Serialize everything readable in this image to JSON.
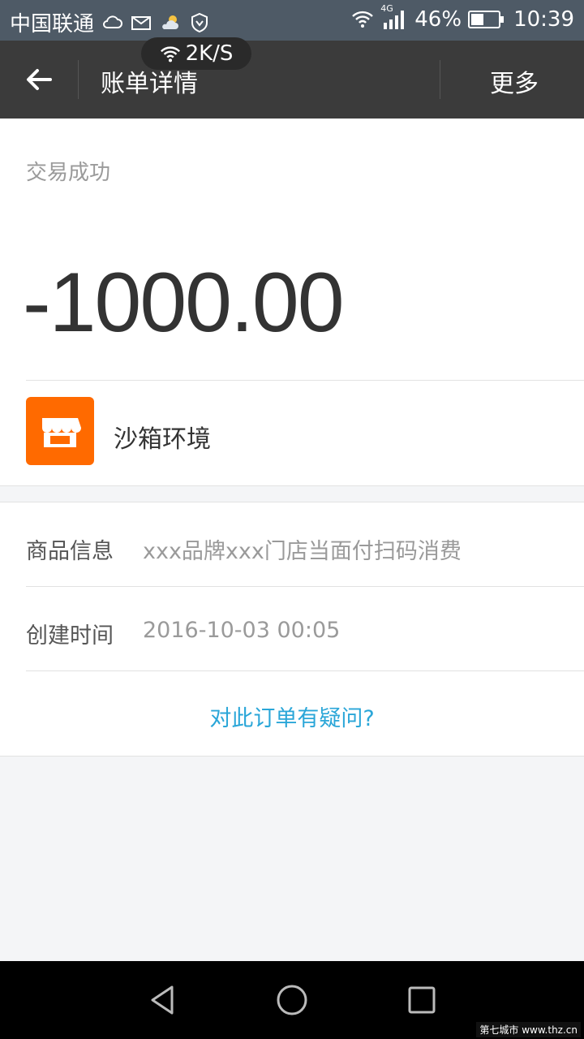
{
  "status_bar": {
    "carrier": "中国联通",
    "network": "4G",
    "battery_percent": "46%",
    "battery_level": 0.46,
    "time": "10:39",
    "net_speed": "2K/S"
  },
  "nav": {
    "title": "账单详情",
    "more_label": "更多"
  },
  "transaction": {
    "status": "交易成功",
    "amount": "-1000.00",
    "merchant_name": "沙箱环境",
    "merchant_logo_color": "#ff6a00"
  },
  "details": {
    "product_label": "商品信息",
    "product_value": "xxx品牌xxx门店当面付扫码消费",
    "created_label": "创建时间",
    "created_value": "2016-10-03 00:05",
    "question_link": "对此订单有疑问?"
  },
  "watermark": "第七城市 www.thz.cn",
  "colors": {
    "status_bar_bg": "#4e5a66",
    "nav_bg": "#3b3b3b",
    "link": "#2aa6d8"
  }
}
